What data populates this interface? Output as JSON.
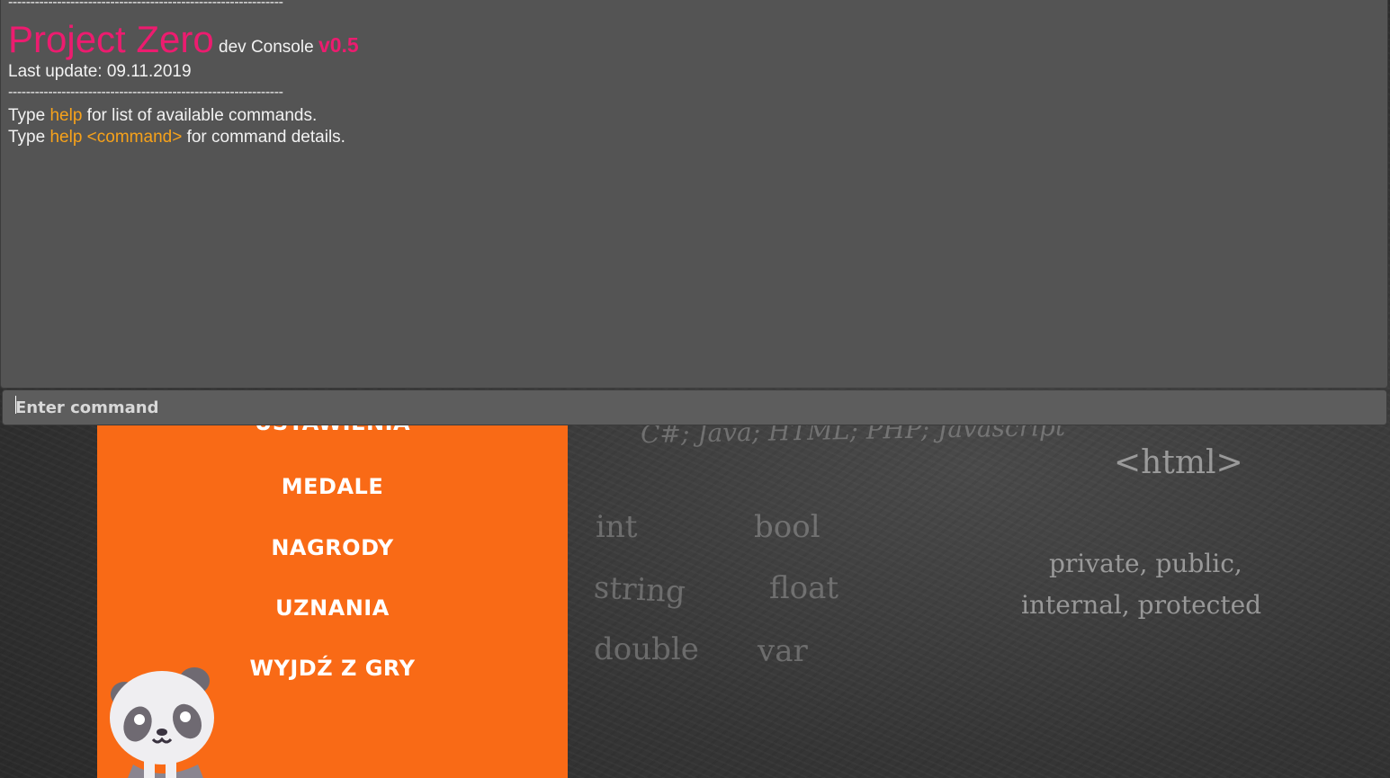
{
  "console": {
    "separator": "--------------------------------------------------------------",
    "title": "Project Zero",
    "subtitle": "dev Console",
    "version": "v0.5",
    "last_update": "Last update: 09.11.2019",
    "help_line1": {
      "prefix": "Type ",
      "keyword": "help",
      "suffix": " for list of available commands."
    },
    "help_line2": {
      "prefix": "Type ",
      "keyword": "help <command>",
      "suffix": " for command details."
    },
    "input_placeholder": "Enter command",
    "colors": {
      "background": "#545454",
      "accent_pink": "#ec1c6f",
      "accent_orange": "#f7a21a"
    }
  },
  "game_menu": {
    "items": [
      "USTAWIENIA",
      "MEDALE",
      "NAGRODY",
      "UZNANIA",
      "WYJDŹ Z GRY"
    ],
    "panel_color": "#f96a16"
  },
  "background_text": {
    "languages": "C#; Java; HTML; PHP; Javascript",
    "html_tag": "<html>",
    "types": [
      "int",
      "bool",
      "string",
      "float",
      "double",
      "var"
    ],
    "modifiers_line1": "private, public,",
    "modifiers_line2": "internal, protected"
  }
}
